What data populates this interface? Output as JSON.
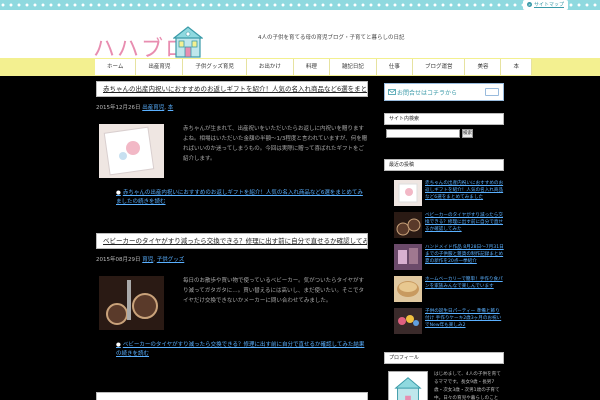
{
  "header": {
    "sitemap_label": "サイトマップ",
    "sitemap_dot": "»",
    "logo_text": "ハハブロ",
    "tagline": "4人の子供を育てる母の育児ブログ・子育てと暮らしの日記"
  },
  "nav": {
    "items": [
      "ホーム",
      "出産育児",
      "子供グッズ育児",
      "お出かけ",
      "料理",
      "雑記日記",
      "仕事",
      "ブログ運営",
      "美容",
      "本"
    ]
  },
  "posts": [
    {
      "title": "赤ちゃんの出産内祝いにおすすめのお返しギフトを紹介！人気の名入れ商品など6選をまとめてみました",
      "date": "2015年12月26日",
      "categories": [
        "出産育児",
        "本"
      ],
      "excerpt": "赤ちゃんが生まれて、出産祝いをいただいたらお返しに内祝いを贈りますよね。相場はいただいた金額の半額〜1/3程度と言われていますが、何を贈ればいいのか迷ってしまうもの。今回は実際に贈って喜ばれたギフトをご紹介します。",
      "more": "赤ちゃんの出産内祝いにおすすめのお返しギフトを紹介！人気の名入れ商品など6選をまとめてみましたの続きを読む"
    },
    {
      "title": "ベビーカーのタイヤがすり減ったら交換できる？修理に出す前に自分で直せるか確認してみた結果",
      "date": "2015年08月29日",
      "categories": [
        "育児",
        "子供グッズ"
      ],
      "excerpt": "毎日のお散歩や買い物で使っているベビーカー。気がついたらタイヤがすり減ってガタガタに…。買い替えるには高いし、まだ使いたい。そこでタイヤだけ交換できないかメーカーに問い合わせてみました。",
      "more": "ベビーカーのタイヤがすり減ったら交換できる？修理に出す前に自分で直せるか確認してみた結果の続きを読む"
    }
  ],
  "sidebar": {
    "contact_label": "お問合せはコチラから",
    "search_heading": "サイト内検索",
    "search_button": "検索",
    "search_placeholder": "",
    "recent_heading": "最近の投稿",
    "recent": [
      "赤ちゃんの出産内祝いにおすすめのお返しギフトを紹介！人気の名入れ商品など6選をまとめてみました",
      "ベビーカーのタイヤがすり減ったら交換できる？修理に出す前に自分で直せるか確認してみた",
      "ハンドメイド作品 8月28日〜7月31日までの子供服と雑貨の制作記録まとめ 夏の新作を20点一挙紹介",
      "ホームベーカリーで簡単！手作り食パンを家族みんなで楽しんでいます",
      "子供の誕生日パーティー 準備と飾り付け 手作りケーキ2歳3ヶ月のお祝いでNew年も楽しみ2"
    ],
    "profile_heading": "プロフィール",
    "profile_text": "はじめまして、4人の子供を育てるママです。長女9歳・長男7歳・次女3歳・次男1歳の子育て中。日々の育児や暮らしのことを綴っています。"
  },
  "colors": {
    "accent": "#8fd9df",
    "nav_bg": "#f3f090",
    "link": "#5ab0ff",
    "logo": "#e88db0"
  }
}
